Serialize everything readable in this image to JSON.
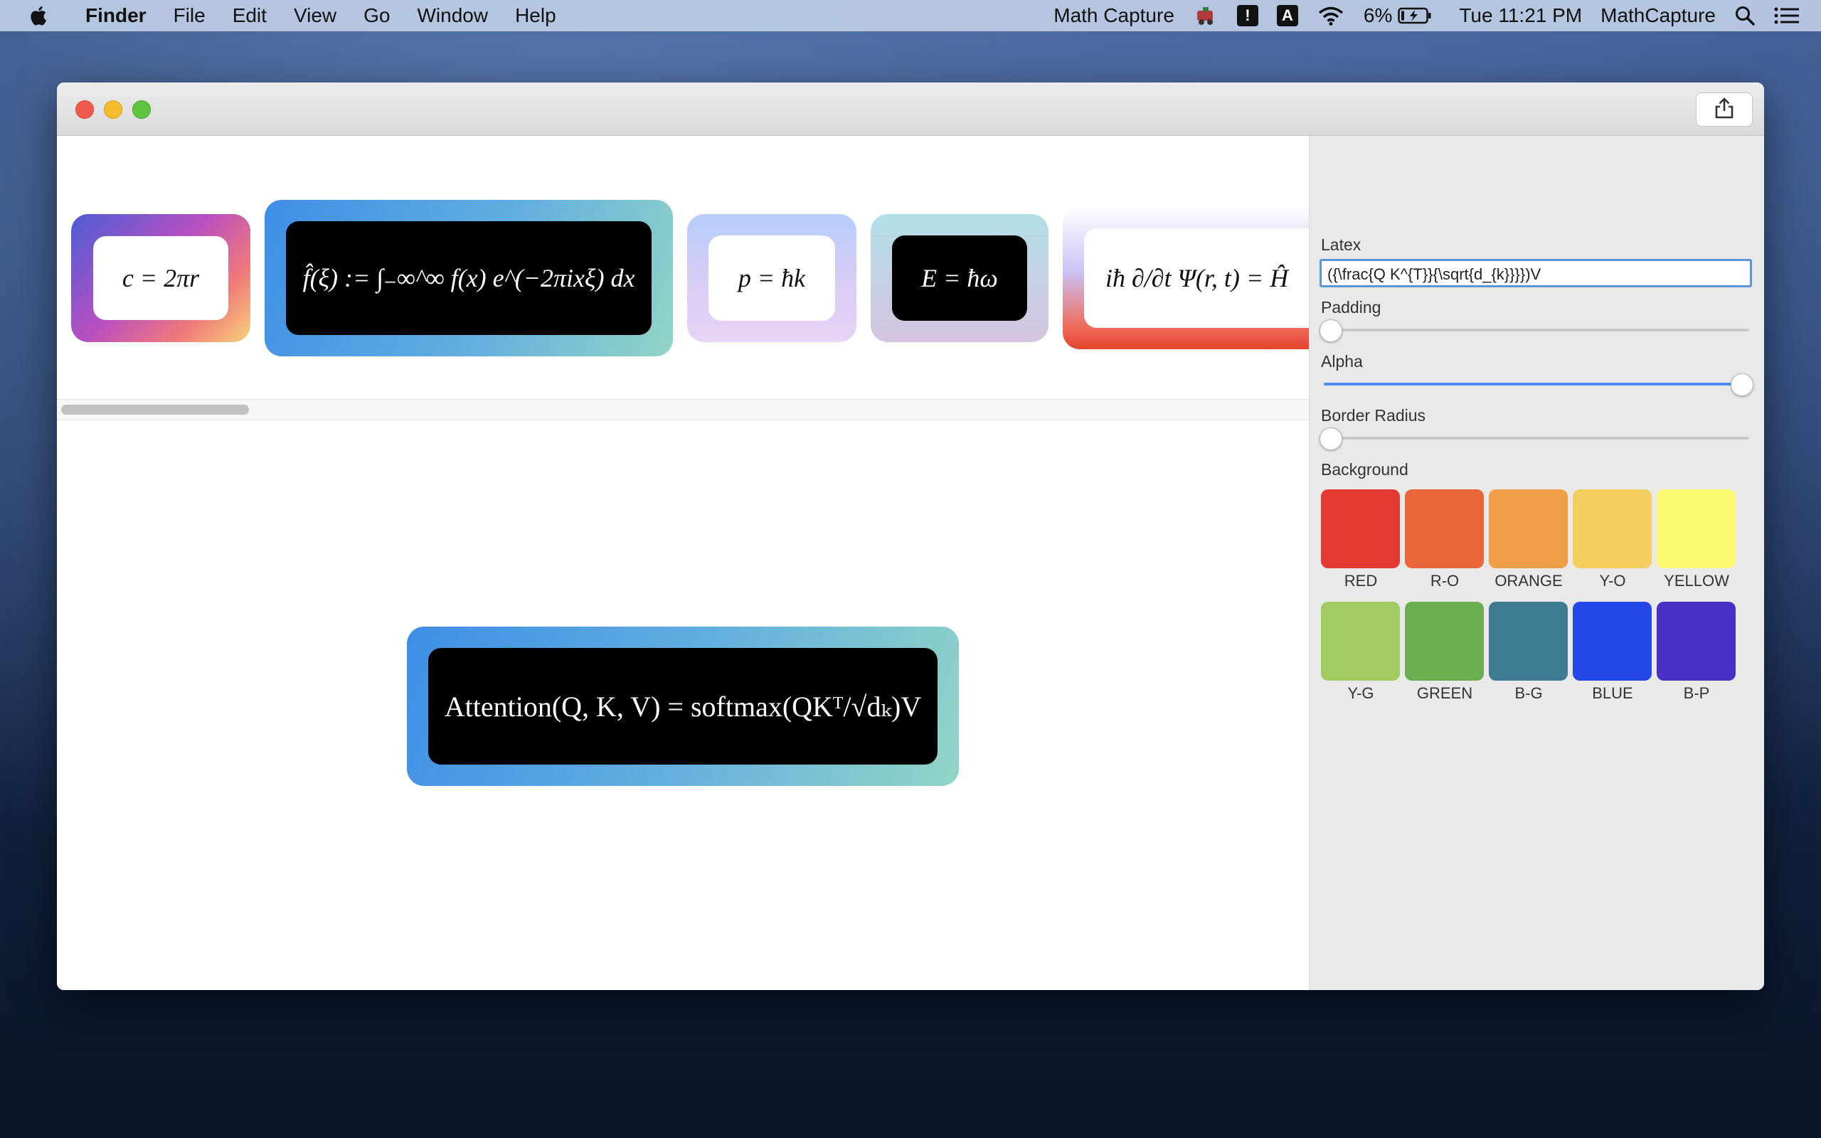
{
  "menubar": {
    "app_name": "Finder",
    "menus": [
      "File",
      "Edit",
      "View",
      "Go",
      "Window",
      "Help"
    ],
    "right_app": "Math Capture",
    "badge1": "!",
    "badge2": "A",
    "battery": "6%",
    "clock": "Tue 11:21 PM",
    "right_app2": "MathCapture"
  },
  "cards": [
    {
      "formula": "c = 2πr"
    },
    {
      "formula": "f̂(ξ) := ∫₋∞^∞ f(x) e^(−2πixξ) dx"
    },
    {
      "formula": "p = ħk"
    },
    {
      "formula": "E = ħω"
    },
    {
      "formula": "iħ ∂/∂t Ψ(r, t) = Ĥ"
    }
  ],
  "preview": {
    "formula": "Attention(Q, K, V) = softmax(QKᵀ/√dₖ)V"
  },
  "panel": {
    "latex_label": "Latex",
    "latex_value": "({\\frac{Q K^{T}}{\\sqrt{d_{k}}}})V",
    "padding_label": "Padding",
    "padding_value": 0,
    "alpha_label": "Alpha",
    "alpha_value": 1,
    "border_radius_label": "Border Radius",
    "border_radius_value": 0,
    "background_label": "Background",
    "swatches": [
      {
        "label": "RED",
        "color": "#e53a33"
      },
      {
        "label": "R-O",
        "color": "#e8673a"
      },
      {
        "label": "ORANGE",
        "color": "#ee9f47"
      },
      {
        "label": "Y-O",
        "color": "#f5cc5e"
      },
      {
        "label": "YELLOW",
        "color": "#fbf771"
      },
      {
        "label": "Y-G",
        "color": "#a2cb61"
      },
      {
        "label": "GREEN",
        "color": "#6cad52"
      },
      {
        "label": "B-G",
        "color": "#3f7a93"
      },
      {
        "label": "BLUE",
        "color": "#2647e8"
      },
      {
        "label": "B-P",
        "color": "#4a2fc4"
      }
    ]
  }
}
